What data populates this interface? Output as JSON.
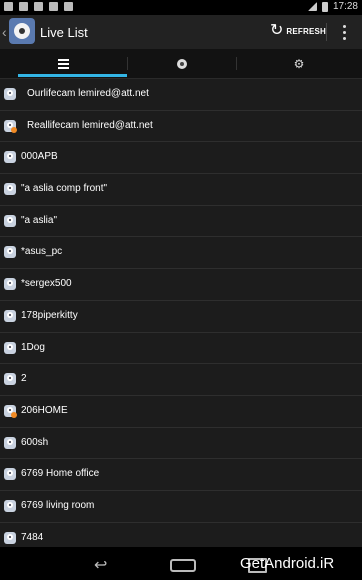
{
  "status_bar": {
    "time": "17:28"
  },
  "action_bar": {
    "title": "Live List",
    "refresh_label": "REFRESH"
  },
  "tabs": [
    {
      "icon": "list-icon"
    },
    {
      "icon": "camera-icon"
    },
    {
      "icon": "gear-icon"
    }
  ],
  "accent_color": "#33b5e5",
  "cameras": [
    {
      "name": "Ourlifecam lemired@att.net",
      "badge": false
    },
    {
      "name": "Reallifecam lemired@att.net",
      "badge": true
    },
    {
      "name": "000APB",
      "badge": false
    },
    {
      "name": "\"a aslia comp front\"",
      "badge": false
    },
    {
      "name": "\"a aslia\"",
      "badge": false
    },
    {
      "name": "*asus_pc",
      "badge": false
    },
    {
      "name": "*sergex500",
      "badge": false
    },
    {
      "name": "178piperkitty",
      "badge": false
    },
    {
      "name": "1Dog",
      "badge": false
    },
    {
      "name": "2",
      "badge": false
    },
    {
      "name": "206HOME",
      "badge": true
    },
    {
      "name": "600sh",
      "badge": false
    },
    {
      "name": "6769 Home office",
      "badge": false
    },
    {
      "name": "6769 living room",
      "badge": false
    },
    {
      "name": "7484",
      "badge": false
    }
  ],
  "watermark": "GetAndroid.iR"
}
